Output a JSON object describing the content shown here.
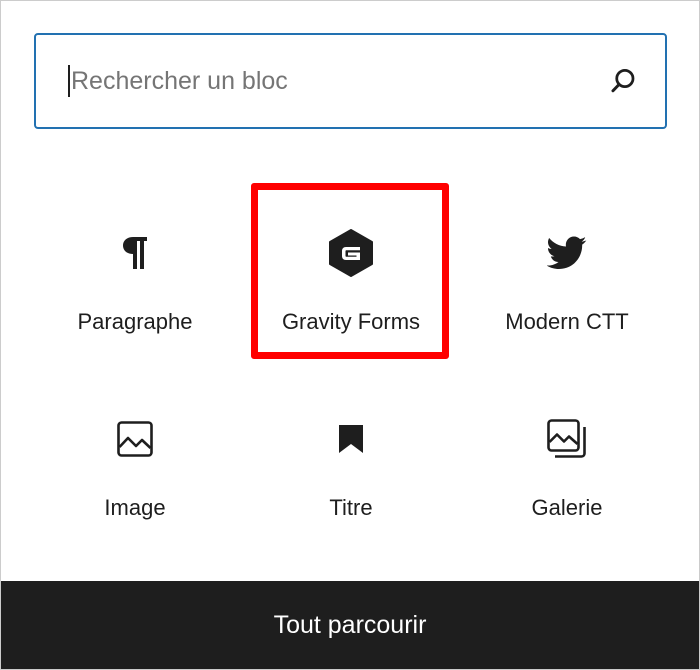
{
  "search": {
    "placeholder": "Rechercher un bloc",
    "value": ""
  },
  "blocks": [
    {
      "label": "Paragraphe",
      "icon": "paragraph-icon"
    },
    {
      "label": "Gravity Forms",
      "icon": "gravity-forms-icon"
    },
    {
      "label": "Modern CTT",
      "icon": "twitter-bird-icon"
    },
    {
      "label": "Image",
      "icon": "image-icon"
    },
    {
      "label": "Titre",
      "icon": "bookmark-icon"
    },
    {
      "label": "Galerie",
      "icon": "gallery-icon"
    }
  ],
  "footer": {
    "browse_all_label": "Tout parcourir"
  },
  "colors": {
    "accent": "#2271b1",
    "highlight": "#ff0000",
    "text": "#1e1e1e",
    "footer_bg": "#1e1e1e"
  }
}
